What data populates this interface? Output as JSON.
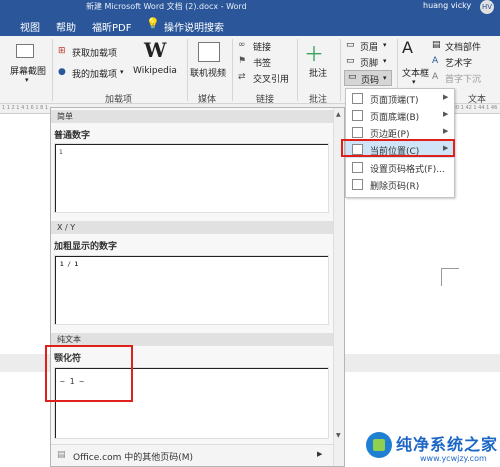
{
  "titlebar": {
    "title": "新建 Microsoft Word 文档 (2).docx - Word",
    "user": "huang vicky",
    "avatar": "HV"
  },
  "tabs": {
    "view": "视图",
    "help": "帮助",
    "foxit": "福昕PDF",
    "tellme": "操作说明搜索"
  },
  "ribbon": {
    "screenshot": "屏幕截图",
    "get_addins": "获取加载项",
    "my_addins": "我的加载项",
    "wikipedia": "Wikipedia",
    "addins_group": "加载项",
    "online_video": "联机视频",
    "media_group": "媒体",
    "link": "链接",
    "bookmark": "书签",
    "cross_ref": "交叉引用",
    "links_group": "链接",
    "comment": "批注",
    "comments_group": "批注",
    "header": "页眉",
    "footer": "页脚",
    "page_number": "页码",
    "textbox": "文本框",
    "doc_parts": "文档部件",
    "wordart": "艺术字",
    "dropcap": "首字下沉",
    "text_group": "文本"
  },
  "ruler_left": "1 1 2 1 4 1 6 1 8 1",
  "ruler_right": "38 1 40 1 42 1 44 1 46",
  "submenu": {
    "items": [
      {
        "label": "页面顶端(T)",
        "arrow": "▶"
      },
      {
        "label": "页面底端(B)",
        "arrow": "▶"
      },
      {
        "label": "页边距(P)",
        "arrow": "▶"
      },
      {
        "label": "当前位置(C)",
        "arrow": "▶"
      },
      {
        "label": "设置页码格式(F)...",
        "arrow": ""
      },
      {
        "label": "删除页码(R)",
        "arrow": ""
      }
    ]
  },
  "gallery": {
    "sections": [
      {
        "header": "简单",
        "name": "普通数字",
        "sample": "1"
      },
      {
        "header": "X / Y",
        "name": "加粗显示的数字",
        "sample": "1 / 1"
      },
      {
        "header": "纯文本",
        "name": "颚化符",
        "sample": "~ 1 ~"
      }
    ],
    "footer_item": "Office.com 中的其他页码(M)",
    "footer_arrow": "▶"
  },
  "watermark": {
    "brand": "纯净系统之家",
    "url": "www.ycwjzy.com"
  },
  "colors": {
    "accent": "#2b579a",
    "highlight": "#e0201a",
    "active_item": "#cfe4f7"
  }
}
